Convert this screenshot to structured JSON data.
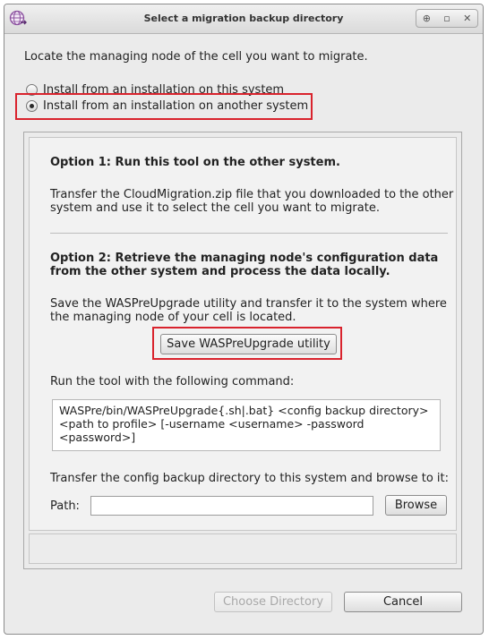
{
  "window": {
    "title": "Select a migration backup directory",
    "buttons": [
      "⊕",
      "▫",
      "✕"
    ]
  },
  "intro": "Locate the managing node of the cell you want to migrate.",
  "radios": [
    {
      "label": "Install from an installation on this system",
      "selected": false
    },
    {
      "label": "Install from an installation on another system",
      "selected": true
    }
  ],
  "option1": {
    "heading": "Option 1: Run this tool on the other system.",
    "line1": "Transfer the CloudMigration.zip file that you downloaded to the other",
    "line2": "system and use it to select the cell you want to migrate."
  },
  "option2": {
    "heading_line1": "Option 2: Retrieve the managing node's configuration data",
    "heading_line2": "from the other system and process the data locally.",
    "line1": "Save the WASPreUpgrade utility and transfer it to the system where",
    "line2": "the managing node of your cell is located.",
    "save_button": "Save WASPreUpgrade utility",
    "command_label": "Run the tool with the following command:",
    "command_lines": [
      "WASPre/bin/WASPreUpgrade{.sh|.bat} <config backup directory>",
      "<path to profile> [-username <username> -password",
      "<password>]"
    ],
    "transfer_text": "Transfer the config backup directory to this system and browse to it:",
    "path_label": "Path:",
    "path_value": "",
    "browse_button": "Browse"
  },
  "footer": {
    "choose_button": "Choose Directory",
    "cancel_button": "Cancel"
  }
}
